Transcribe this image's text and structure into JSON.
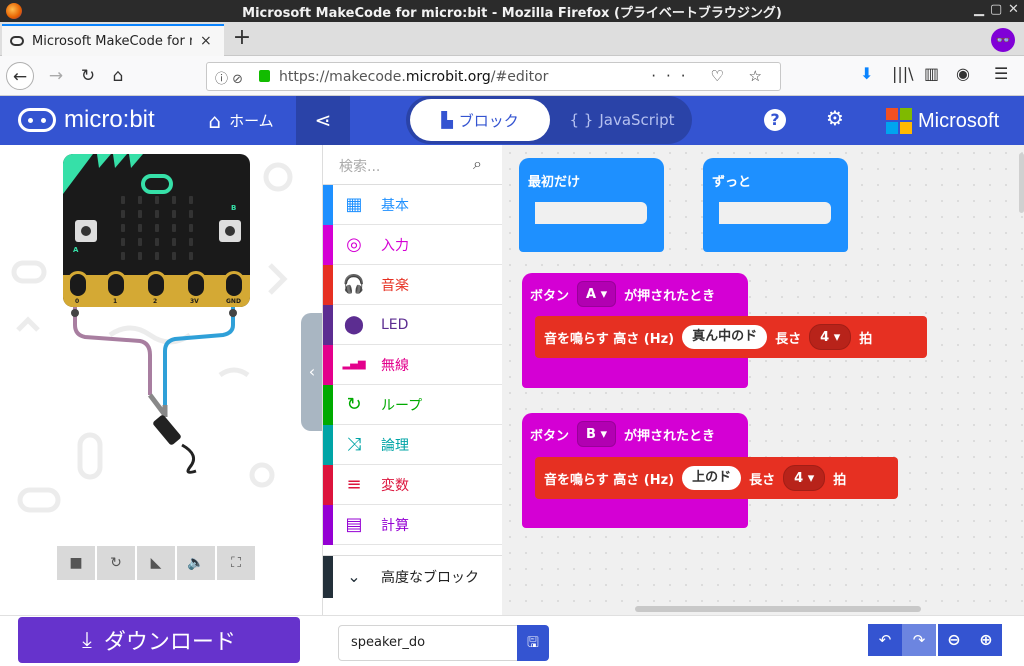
{
  "window": {
    "title": "Microsoft MakeCode for micro:bit - Mozilla Firefox (プライベートブラウジング)"
  },
  "tab": {
    "label": "Microsoft MakeCode for m",
    "close": "×",
    "new": "+"
  },
  "nav": {
    "url_prefix": "https://makecode.",
    "url_domain": "microbit.org",
    "url_suffix": "/#editor",
    "page_actions": "··· ♡ ☆"
  },
  "header": {
    "logo_text": "micro:bit",
    "home_label": "ホーム",
    "blocks_label": "ブロック",
    "javascript_label": "JavaScript",
    "microsoft_label": "Microsoft"
  },
  "simulator": {
    "pins": [
      "0",
      "1",
      "2",
      "3V",
      "GND"
    ],
    "button_a": "A",
    "button_b": "B"
  },
  "toolbox": {
    "search_placeholder": "検索...",
    "categories": [
      {
        "name": "基本",
        "color": "#1e90ff",
        "icon": "grid-icon"
      },
      {
        "name": "入力",
        "color": "#d400d4",
        "icon": "target-icon"
      },
      {
        "name": "音楽",
        "color": "#e63022",
        "icon": "headphones-icon"
      },
      {
        "name": "LED",
        "color": "#5c2d91",
        "icon": "toggle-icon"
      },
      {
        "name": "無線",
        "color": "#e3008c",
        "icon": "signal-icon"
      },
      {
        "name": "ループ",
        "color": "#00aa00",
        "icon": "loop-icon"
      },
      {
        "name": "論理",
        "color": "#00a4a6",
        "icon": "shuffle-icon"
      },
      {
        "name": "変数",
        "color": "#dc143c",
        "icon": "lines-icon"
      },
      {
        "name": "計算",
        "color": "#9400d3",
        "icon": "calculator-icon"
      }
    ],
    "advanced_label": "高度なブロック"
  },
  "workspace": {
    "on_start_label": "最初だけ",
    "forever_label": "ずっと",
    "events": [
      {
        "prefix": "ボタン",
        "button": "A",
        "suffix": "が押されたとき",
        "stmt": "音を鳴らす 高さ (Hz)",
        "note": "真ん中のド",
        "length_label": "長さ",
        "beats": "4",
        "unit": "拍"
      },
      {
        "prefix": "ボタン",
        "button": "B",
        "suffix": "が押されたとき",
        "stmt": "音を鳴らす 高さ (Hz)",
        "note": "上のド",
        "length_label": "長さ",
        "beats": "4",
        "unit": "拍"
      }
    ]
  },
  "bottom": {
    "download_label": "ダウンロード",
    "filename": "speaker_do"
  }
}
